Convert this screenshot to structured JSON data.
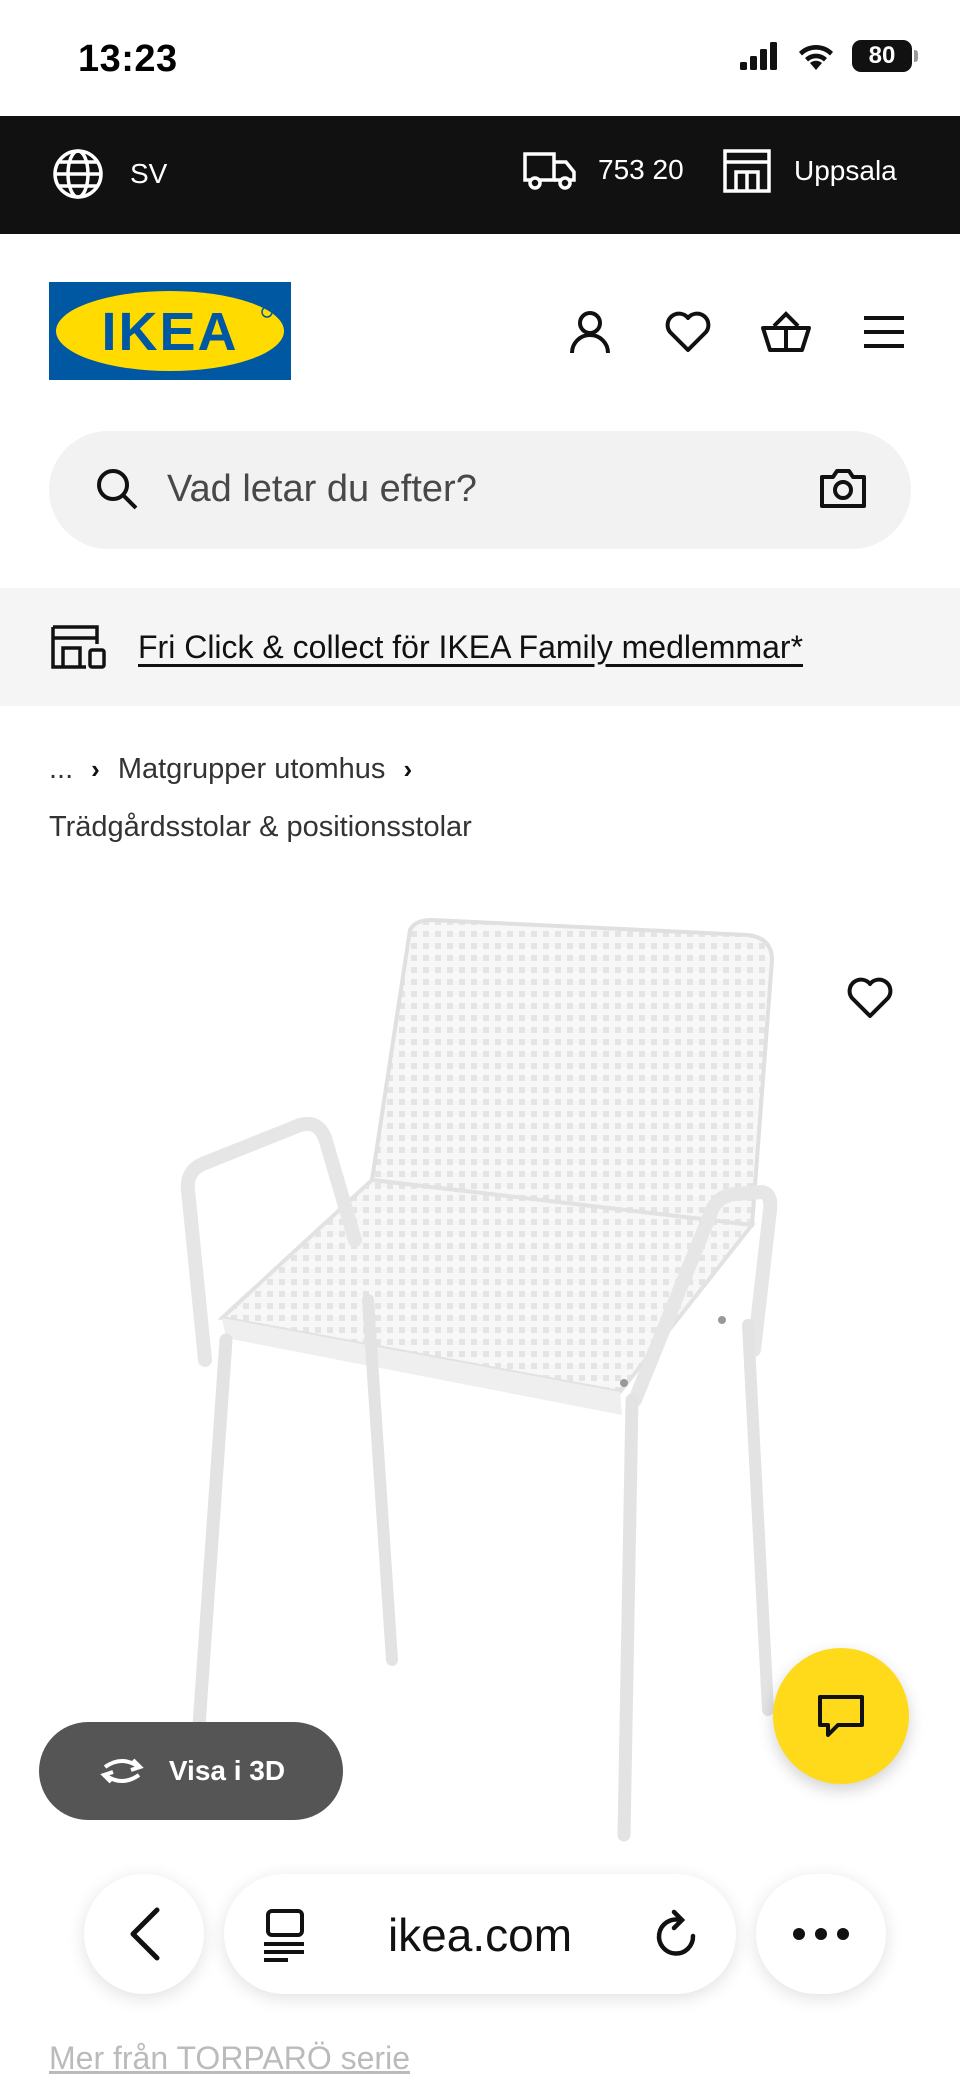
{
  "status_bar": {
    "time": "13:23",
    "battery": "80"
  },
  "top_bar": {
    "language": "SV",
    "postcode": "753 20",
    "store": "Uppsala"
  },
  "header": {
    "logo_text": "IKEA"
  },
  "search": {
    "placeholder": "Vad letar du efter?"
  },
  "promo": {
    "text": "Fri Click & collect för IKEA Family medlemmar*"
  },
  "breadcrumb": {
    "ellipsis": "...",
    "item1": "Matgrupper utomhus",
    "item2": "Trädgårdsstolar & positionsstolar"
  },
  "product": {
    "view3d_label": "Visa i 3D"
  },
  "browser": {
    "domain": "ikea.com"
  },
  "footer_link": "Mer från TORPARÖ serie",
  "colors": {
    "brand_blue": "#0058A3",
    "brand_yellow": "#FFDB00",
    "chat_yellow": "#FFDA1A",
    "top_bar_bg": "#111111"
  }
}
